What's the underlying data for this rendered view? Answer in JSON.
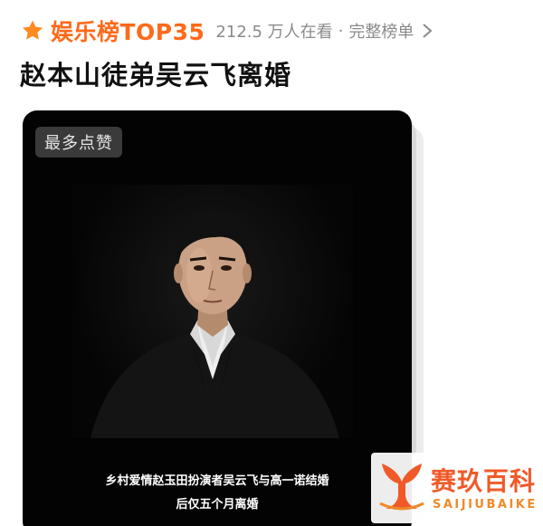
{
  "header": {
    "ranking_title": "娱乐榜TOP35",
    "viewer_count": "212.5 万人在看",
    "separator": "·",
    "full_list_label": "完整榜单",
    "icons": {
      "star": "star-icon",
      "chevron": "chevron-right-icon"
    }
  },
  "topic": {
    "title": "赵本山徒弟吴云飞离婚"
  },
  "card": {
    "badge": "最多点赞",
    "caption_line1": "乡村爱情赵玉田扮演者吴云飞与高一诺结婚",
    "caption_line2": "后仅五个月离婚"
  },
  "watermark": {
    "chinese": "赛玖百科",
    "english": "SAIJIUBAIKE"
  },
  "colors": {
    "accent": "#ff6a1a",
    "card_background": "#030303",
    "muted_text": "#8a8a8a"
  }
}
